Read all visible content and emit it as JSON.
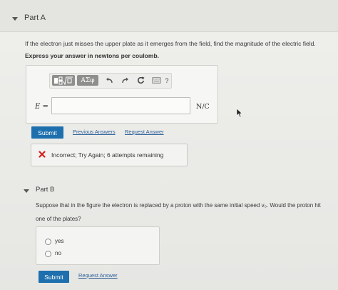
{
  "part_a": {
    "title": "Part A",
    "question": "If the electron just misses the upper plate as it emerges from the field, find the magnitude of the electric field.",
    "instruction": "Express your answer in newtons per coulomb.",
    "toolbar": {
      "greek_label": "ΑΣφ",
      "help_label": "?"
    },
    "variable_label": "E =",
    "answer_value": "",
    "unit": "N/C",
    "submit_label": "Submit",
    "previous_answers_label": "Previous Answers",
    "request_answer_label": "Request Answer",
    "feedback": "Incorrect; Try Again; 6 attempts remaining"
  },
  "part_b": {
    "title": "Part B",
    "question_line1": "Suppose that in the figure the electron is replaced by a proton with the same initial speed v₀. Would the proton hit",
    "question_line2": "one of the plates?",
    "options": [
      "yes",
      "no"
    ],
    "submit_label": "Submit",
    "request_answer_label": "Request Answer"
  },
  "colors": {
    "submit_blue": "#1e6fae",
    "link_blue": "#2d5f9a",
    "error_red": "#d2231f"
  }
}
